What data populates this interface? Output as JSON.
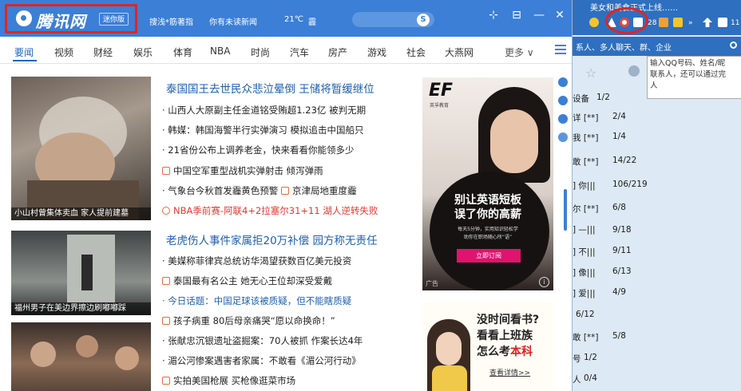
{
  "news_window": {
    "logo": {
      "text": "腾讯网",
      "badge": "迷你版"
    },
    "titlebar": {
      "search_hint": "搜浅*筋著指",
      "unread": "你有未读新闻",
      "weather": "21℃",
      "weather_cond": "霾",
      "search_button": "S"
    },
    "window_controls": {
      "pin": "⊹",
      "restore": "⊟",
      "minimize": "—",
      "close": "✕"
    },
    "nav": {
      "items": [
        "要闻",
        "视频",
        "财经",
        "娱乐",
        "体育",
        "NBA",
        "时尚",
        "汽车",
        "房产",
        "游戏",
        "社会",
        "大燕网"
      ],
      "more": "更多 ∨",
      "menu": "≡"
    },
    "thumbs": [
      {
        "caption": "小山村曾集体卖血 家人提前建墓"
      },
      {
        "caption": "福州男子在美边界擦边刷嘟嘟踩"
      },
      {
        "caption": ""
      }
    ],
    "sections": [
      {
        "headline": "泰国国王去世民众悲泣晕倒 王储将暂缓继位",
        "items": [
          {
            "text": "· 山西人大原副主任金道铭受贿超1.23亿 被判无期",
            "style": "normal"
          },
          {
            "text": "· 韩媒：韩国海警半行实弹演习 模拟追击中国船只",
            "style": "normal"
          },
          {
            "text": "· 21省份公布上调养老金，快来看看你能领多少",
            "style": "normal"
          },
          {
            "text": "中国空军重型战机实弹射击 倾泻弹雨",
            "style": "video"
          },
          {
            "text": "· 气象台今秋首发霾黄色预警",
            "extra": "京津局地重度霾",
            "style": "normal"
          },
          {
            "text": "NBA季前赛-阿联4+2拉塞尔31+11 湖人逆转失败",
            "style": "red"
          }
        ]
      },
      {
        "headline": "老虎伤人事件家属拒20万补偿 园方称无责任",
        "items": [
          {
            "text": "· 美媒称菲律宾总统访华渴望获数百亿美元投资",
            "style": "normal"
          },
          {
            "text": "泰国最有名公主 她无心王位却深受爱戴",
            "style": "video"
          },
          {
            "text": "· 今日话题：中国足球该被质疑，但不能瞎质疑",
            "style": "blue"
          },
          {
            "text": "孩子病重 80后母亲痛哭“愿以命换命！”",
            "style": "video"
          },
          {
            "text": "· 张献忠沉银遗址盗掘案：70人被抓 作案长达4年",
            "style": "normal"
          },
          {
            "text": "· 湄公河惨案遇害者家属：不敢看《湄公河行动》",
            "style": "normal"
          },
          {
            "text": "实拍美国枪展 买枪像逛菜市场",
            "style": "video"
          }
        ]
      }
    ],
    "ad_english": {
      "brand": "EF",
      "brand_sub": "英孚教育",
      "line1": "别让英语短板",
      "line2": "误了你的高薪",
      "small1": "每天5分钟，实用知识轻松学",
      "small2": "助你在职场随心所“语”",
      "button": "立即订阅",
      "tag": "广告",
      "info": "i"
    },
    "ad_study": {
      "line1": "没时间看书?",
      "line2": "看看上班族",
      "line3_prefix": "怎么考",
      "line3_highlight": "本科",
      "detail": "查看详情>>"
    }
  },
  "qq_panel": {
    "title": "美女和美食正式上线……",
    "toolbar_count": "28",
    "toolbar_more": "»",
    "toolbar_num": "11",
    "subbar": "系人、多人聊天、群、企业",
    "tooltip": [
      "输入QQ号码、姓名/昵",
      "联系人，还可以通过完",
      "人"
    ],
    "rows": [
      {
        "label": "设备",
        "count": "1/2"
      },
      {
        "label": "详 [**]",
        "count": "2/4"
      },
      {
        "label": "我 [**]",
        "count": "1/4"
      },
      {
        "label": "敢 [**]",
        "count": "14/22"
      },
      {
        "label": "] 你|||",
        "count": "106/219"
      },
      {
        "label": "尔 [**]",
        "count": "6/8"
      },
      {
        "label": "] —|||",
        "count": "9/18"
      },
      {
        "label": "] 不|||",
        "count": "9/11"
      },
      {
        "label": "] 像|||",
        "count": "6/13"
      },
      {
        "label": "] 爱|||",
        "count": "4/9"
      },
      {
        "label": "",
        "count": "6/12"
      },
      {
        "label": "敢 [**]",
        "count": "5/8"
      },
      {
        "label": "号",
        "count": "1/2"
      },
      {
        "label": "人",
        "count": "0/4"
      }
    ]
  }
}
